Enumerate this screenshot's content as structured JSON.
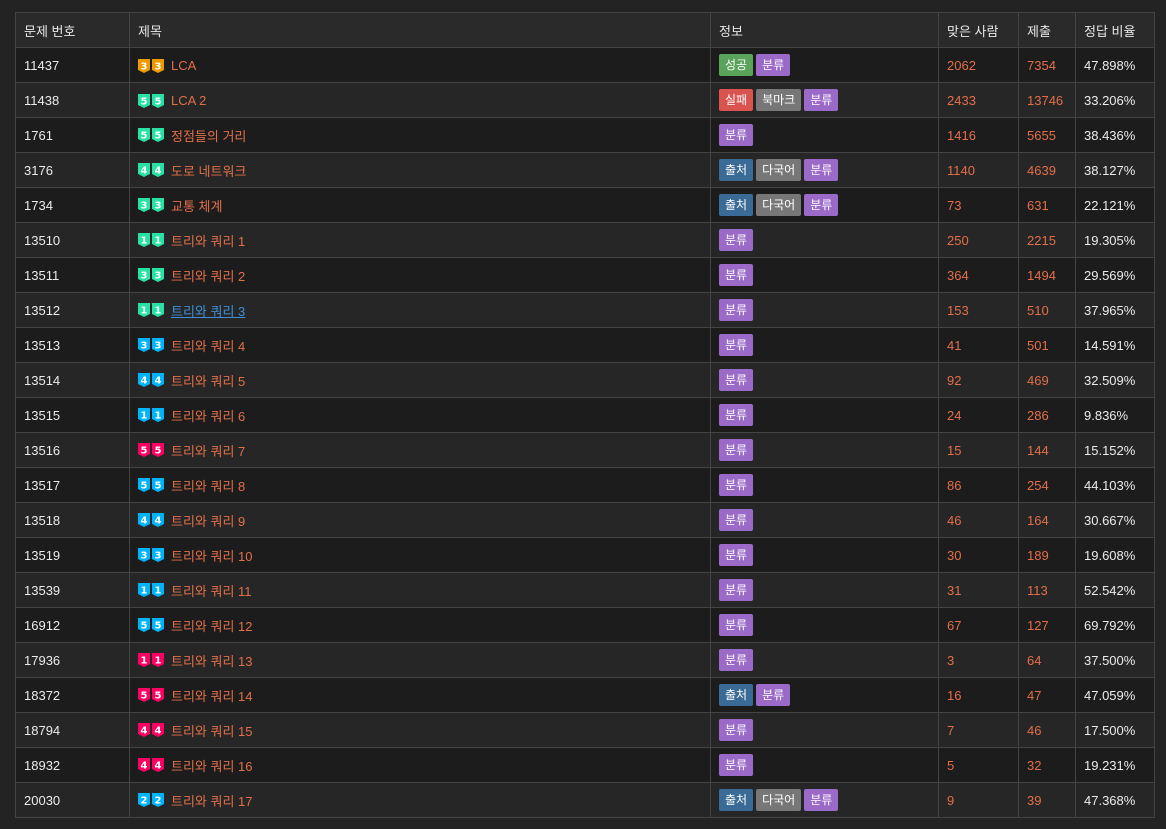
{
  "columns": [
    "문제 번호",
    "제목",
    "정보",
    "맞은 사람",
    "제출",
    "정답 비율"
  ],
  "badge_labels": {
    "success": "성공",
    "fail": "실패",
    "bookmark": "북마크",
    "category": "분류",
    "source": "출처",
    "multilang": "다국어"
  },
  "tier_colors": {
    "bronze": "#ad5600",
    "silver": "#435f7a",
    "gold": "#ec9a00",
    "platinum": "#27e2a4",
    "diamond": "#00b4fc",
    "ruby": "#ff0062"
  },
  "rows": [
    {
      "id": "11437",
      "title": "LCA",
      "tier": "gold",
      "level": "3",
      "badges": [
        "success",
        "category"
      ],
      "solved": "2062",
      "submissions": "7354",
      "ratio": "47.898%"
    },
    {
      "id": "11438",
      "title": "LCA 2",
      "tier": "platinum",
      "level": "5",
      "badges": [
        "fail",
        "bookmark",
        "category"
      ],
      "solved": "2433",
      "submissions": "13746",
      "ratio": "33.206%"
    },
    {
      "id": "1761",
      "title": "정점들의 거리",
      "tier": "platinum",
      "level": "5",
      "badges": [
        "category"
      ],
      "solved": "1416",
      "submissions": "5655",
      "ratio": "38.436%"
    },
    {
      "id": "3176",
      "title": "도로 네트워크",
      "tier": "platinum",
      "level": "4",
      "badges": [
        "source",
        "multilang",
        "category"
      ],
      "solved": "1140",
      "submissions": "4639",
      "ratio": "38.127%"
    },
    {
      "id": "1734",
      "title": "교통 체계",
      "tier": "platinum",
      "level": "3",
      "badges": [
        "source",
        "multilang",
        "category"
      ],
      "solved": "73",
      "submissions": "631",
      "ratio": "22.121%"
    },
    {
      "id": "13510",
      "title": "트리와 쿼리 1",
      "tier": "platinum",
      "level": "1",
      "badges": [
        "category"
      ],
      "solved": "250",
      "submissions": "2215",
      "ratio": "19.305%"
    },
    {
      "id": "13511",
      "title": "트리와 쿼리 2",
      "tier": "platinum",
      "level": "3",
      "badges": [
        "category"
      ],
      "solved": "364",
      "submissions": "1494",
      "ratio": "29.569%"
    },
    {
      "id": "13512",
      "title": "트리와 쿼리 3",
      "tier": "platinum",
      "level": "1",
      "badges": [
        "category"
      ],
      "solved": "153",
      "submissions": "510",
      "ratio": "37.965%",
      "link_style": "visited"
    },
    {
      "id": "13513",
      "title": "트리와 쿼리 4",
      "tier": "diamond",
      "level": "3",
      "badges": [
        "category"
      ],
      "solved": "41",
      "submissions": "501",
      "ratio": "14.591%"
    },
    {
      "id": "13514",
      "title": "트리와 쿼리 5",
      "tier": "diamond",
      "level": "4",
      "badges": [
        "category"
      ],
      "solved": "92",
      "submissions": "469",
      "ratio": "32.509%"
    },
    {
      "id": "13515",
      "title": "트리와 쿼리 6",
      "tier": "diamond",
      "level": "1",
      "badges": [
        "category"
      ],
      "solved": "24",
      "submissions": "286",
      "ratio": "9.836%"
    },
    {
      "id": "13516",
      "title": "트리와 쿼리 7",
      "tier": "ruby",
      "level": "5",
      "badges": [
        "category"
      ],
      "solved": "15",
      "submissions": "144",
      "ratio": "15.152%"
    },
    {
      "id": "13517",
      "title": "트리와 쿼리 8",
      "tier": "diamond",
      "level": "5",
      "badges": [
        "category"
      ],
      "solved": "86",
      "submissions": "254",
      "ratio": "44.103%"
    },
    {
      "id": "13518",
      "title": "트리와 쿼리 9",
      "tier": "diamond",
      "level": "4",
      "badges": [
        "category"
      ],
      "solved": "46",
      "submissions": "164",
      "ratio": "30.667%"
    },
    {
      "id": "13519",
      "title": "트리와 쿼리 10",
      "tier": "diamond",
      "level": "3",
      "badges": [
        "category"
      ],
      "solved": "30",
      "submissions": "189",
      "ratio": "19.608%"
    },
    {
      "id": "13539",
      "title": "트리와 쿼리 11",
      "tier": "diamond",
      "level": "1",
      "badges": [
        "category"
      ],
      "solved": "31",
      "submissions": "113",
      "ratio": "52.542%"
    },
    {
      "id": "16912",
      "title": "트리와 쿼리 12",
      "tier": "diamond",
      "level": "5",
      "badges": [
        "category"
      ],
      "solved": "67",
      "submissions": "127",
      "ratio": "69.792%"
    },
    {
      "id": "17936",
      "title": "트리와 쿼리 13",
      "tier": "ruby",
      "level": "1",
      "badges": [
        "category"
      ],
      "solved": "3",
      "submissions": "64",
      "ratio": "37.500%"
    },
    {
      "id": "18372",
      "title": "트리와 쿼리 14",
      "tier": "ruby",
      "level": "5",
      "badges": [
        "source",
        "category"
      ],
      "solved": "16",
      "submissions": "47",
      "ratio": "47.059%"
    },
    {
      "id": "18794",
      "title": "트리와 쿼리 15",
      "tier": "ruby",
      "level": "4",
      "badges": [
        "category"
      ],
      "solved": "7",
      "submissions": "46",
      "ratio": "17.500%"
    },
    {
      "id": "18932",
      "title": "트리와 쿼리 16",
      "tier": "ruby",
      "level": "4",
      "badges": [
        "category"
      ],
      "solved": "5",
      "submissions": "32",
      "ratio": "19.231%"
    },
    {
      "id": "20030",
      "title": "트리와 쿼리 17",
      "tier": "diamond",
      "level": "2",
      "badges": [
        "source",
        "multilang",
        "category"
      ],
      "solved": "9",
      "submissions": "39",
      "ratio": "47.368%"
    }
  ]
}
